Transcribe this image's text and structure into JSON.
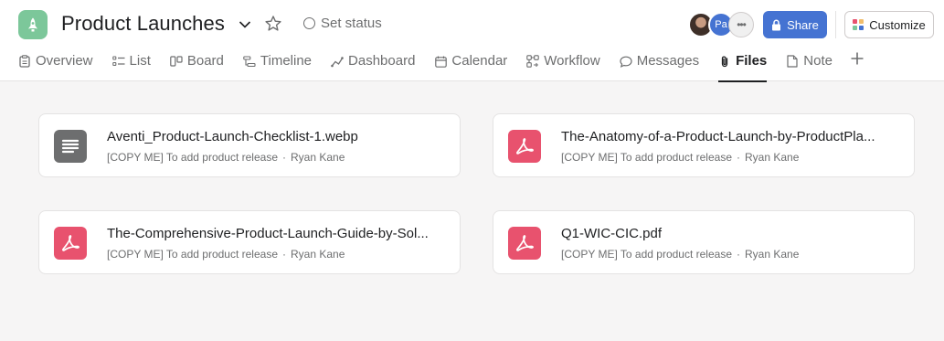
{
  "header": {
    "project_title": "Product Launches",
    "set_status_label": "Set status",
    "share_label": "Share",
    "customize_label": "Customize",
    "avatar_initials": "Pa",
    "avatar_more": "•••"
  },
  "tabs": [
    {
      "label": "Overview",
      "icon": "clipboard-icon"
    },
    {
      "label": "List",
      "icon": "list-icon"
    },
    {
      "label": "Board",
      "icon": "board-icon"
    },
    {
      "label": "Timeline",
      "icon": "timeline-icon"
    },
    {
      "label": "Dashboard",
      "icon": "dashboard-icon"
    },
    {
      "label": "Calendar",
      "icon": "calendar-icon"
    },
    {
      "label": "Workflow",
      "icon": "workflow-icon"
    },
    {
      "label": "Messages",
      "icon": "message-icon"
    },
    {
      "label": "Files",
      "icon": "paperclip-icon",
      "active": true
    },
    {
      "label": "Note",
      "icon": "note-icon"
    }
  ],
  "files": [
    {
      "name": "Aventi_Product-Launch-Checklist-1.webp",
      "task": "[COPY ME] To add product release",
      "author": "Ryan Kane",
      "type": "doc"
    },
    {
      "name": "The-Anatomy-of-a-Product-Launch-by-ProductPla...",
      "task": "[COPY ME] To add product release",
      "author": "Ryan Kane",
      "type": "pdf"
    },
    {
      "name": "The-Comprehensive-Product-Launch-Guide-by-Sol...",
      "task": "[COPY ME] To add product release",
      "author": "Ryan Kane",
      "type": "pdf"
    },
    {
      "name": "Q1-WIC-CIC.pdf",
      "task": "[COPY ME] To add product release",
      "author": "Ryan Kane",
      "type": "pdf"
    }
  ],
  "meta_separator": "·",
  "colors": {
    "accent": "#4573d2",
    "project_icon": "#7cc79a",
    "pdf": "#e8526e",
    "doc": "#6d6e6f"
  }
}
